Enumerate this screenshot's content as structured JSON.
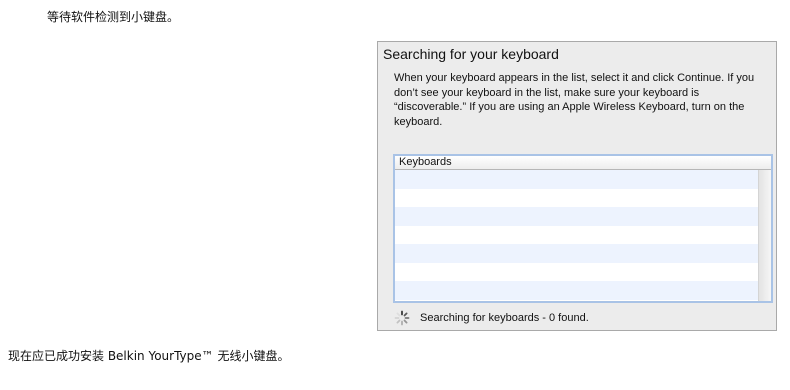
{
  "instructions": {
    "top": "等待软件检测到小键盘。",
    "bottom": "现在应已成功安装 Belkin YourType™ 无线小键盘。"
  },
  "dialog": {
    "title": "Searching for your keyboard",
    "description": "When your keyboard appears in the list, select it and click Continue. If you don’t see your keyboard in the list, make sure your keyboard is “discoverable.” If you are using an Apple Wireless Keyboard, turn on the keyboard.",
    "list": {
      "header": "Keyboards",
      "rows": []
    },
    "status": {
      "icon": "spinner-icon",
      "text": "Searching for keyboards - 0 found."
    }
  }
}
